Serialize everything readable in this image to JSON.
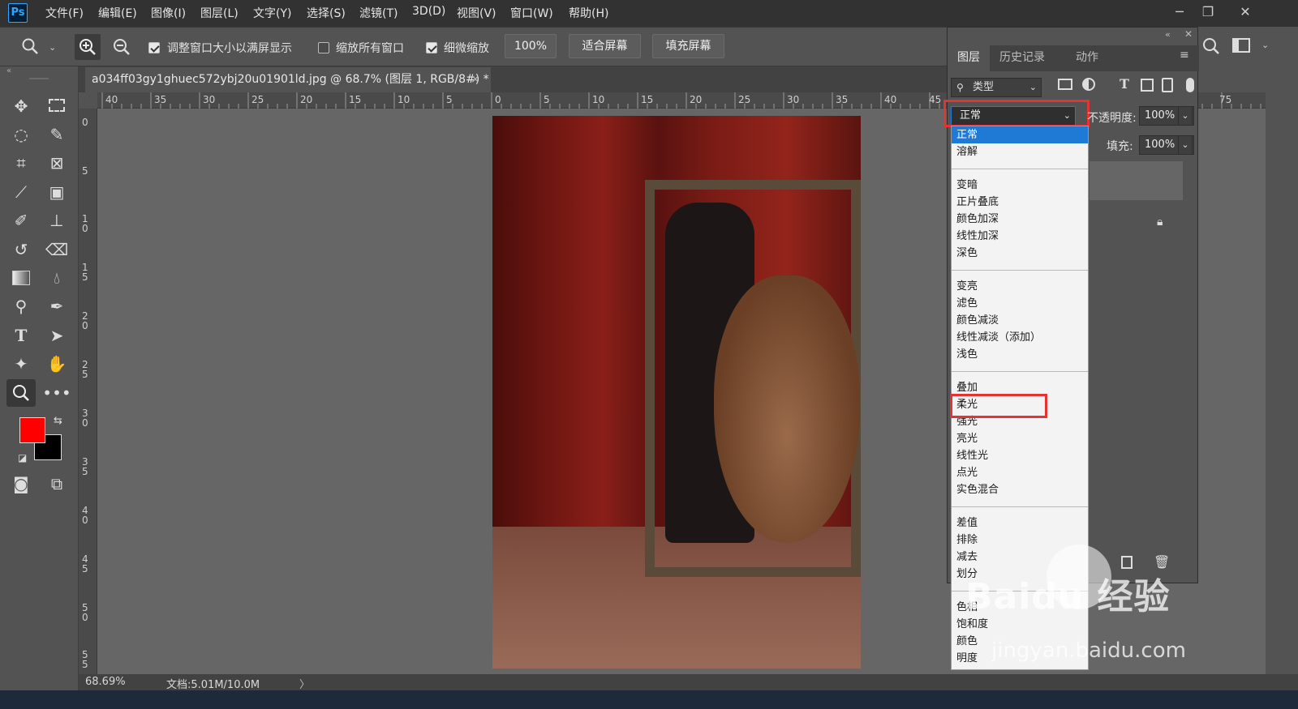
{
  "app": {
    "logo": "Ps"
  },
  "menu": [
    "文件(F)",
    "编辑(E)",
    "图像(I)",
    "图层(L)",
    "文字(Y)",
    "选择(S)",
    "滤镜(T)",
    "3D(D)",
    "视图(V)",
    "窗口(W)",
    "帮助(H)"
  ],
  "window_controls": {
    "minimize": "─",
    "restore": "❐",
    "close": "✕"
  },
  "options": {
    "resize_windows_label": "调整窗口大小以满屏显示",
    "resize_windows_checked": true,
    "zoom_all_label": "缩放所有窗口",
    "zoom_all_checked": false,
    "scrubby_label": "细微缩放",
    "scrubby_checked": true,
    "zoom_value": "100%",
    "fit_screen": "适合屏幕",
    "fill_screen": "填充屏幕"
  },
  "document": {
    "tab_title": "a034ff03gy1ghuec572ybj20u01901ld.jpg @ 68.7% (图层 1, RGB/8#) *",
    "close": "×"
  },
  "ruler_h": [
    "40",
    "35",
    "30",
    "25",
    "20",
    "15",
    "10",
    "5",
    "0",
    "5",
    "10",
    "15",
    "20",
    "25",
    "30",
    "35",
    "40",
    "45",
    "75"
  ],
  "ruler_v": [
    "0",
    "5",
    "1\n0",
    "1\n5",
    "2\n0",
    "2\n5",
    "3\n0",
    "3\n5",
    "4\n0",
    "4\n5",
    "5\n0",
    "5\n5"
  ],
  "status": {
    "zoom": "68.69%",
    "doc": "文档:5.01M/10.0M",
    "arrow": "〉"
  },
  "colors": {
    "foreground": "#ff0000",
    "background": "#000000",
    "highlight": "#e33333",
    "selection": "#1f7ad6"
  },
  "layers_panel": {
    "tabs": [
      "图层",
      "历史记录",
      "动作"
    ],
    "filter_label": "类型",
    "blend_mode": "正常",
    "opacity_label": "不透明度:",
    "opacity_value": "100%",
    "fill_label": "填充:",
    "fill_value": "100%"
  },
  "blend_modes": [
    [
      "正常",
      "溶解"
    ],
    [
      "变暗",
      "正片叠底",
      "颜色加深",
      "线性加深",
      "深色"
    ],
    [
      "变亮",
      "滤色",
      "颜色减淡",
      "线性减淡（添加）",
      "浅色"
    ],
    [
      "叠加",
      "柔光",
      "强光",
      "亮光",
      "线性光",
      "点光",
      "实色混合"
    ],
    [
      "差值",
      "排除",
      "减去",
      "划分"
    ],
    [
      "色相",
      "饱和度",
      "颜色",
      "明度"
    ]
  ],
  "watermark": {
    "brand": "Baidu 经验",
    "url": "jingyan.baidu.com"
  }
}
